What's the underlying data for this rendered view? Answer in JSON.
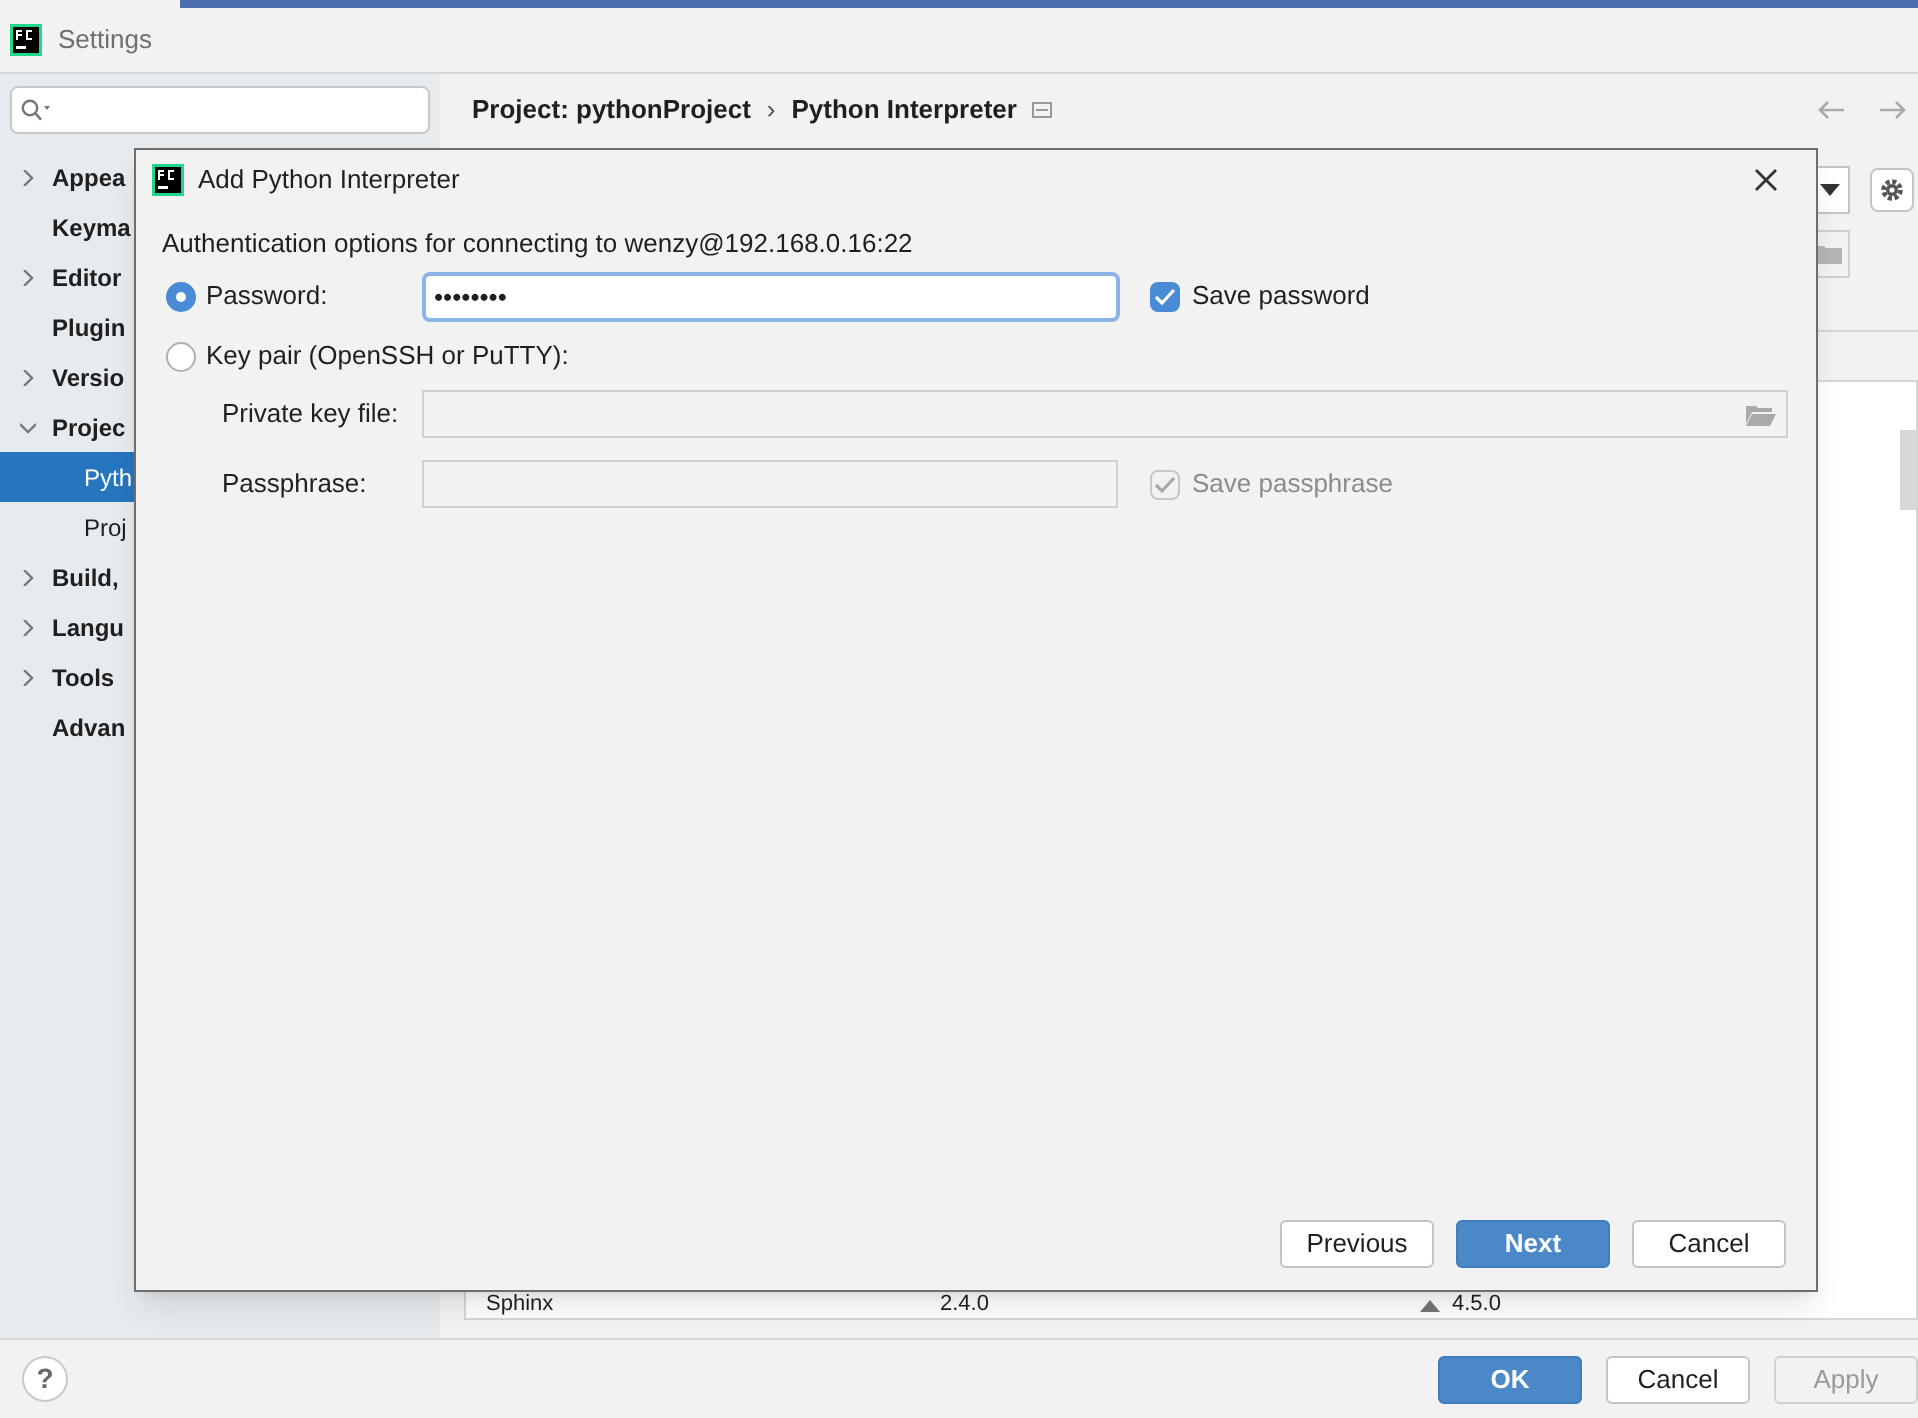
{
  "window": {
    "title": "Settings"
  },
  "sidebar": {
    "items": [
      {
        "label": "Appea",
        "expanded": false,
        "selected": false
      },
      {
        "label": "Keyma",
        "selected": false
      },
      {
        "label": "Editor",
        "expanded": false,
        "selected": false
      },
      {
        "label": "Plugin",
        "selected": false
      },
      {
        "label": "Versio",
        "expanded": false,
        "selected": false
      },
      {
        "label": "Projec",
        "expanded": true,
        "selected": false,
        "children": [
          {
            "label": "Pyth",
            "selected": true
          },
          {
            "label": "Proj",
            "selected": false
          }
        ]
      },
      {
        "label": "Build,",
        "expanded": false,
        "selected": false
      },
      {
        "label": "Langu",
        "expanded": false,
        "selected": false
      },
      {
        "label": "Tools",
        "expanded": false,
        "selected": false
      },
      {
        "label": "Advan",
        "selected": false
      }
    ]
  },
  "breadcrumb": [
    "Project: pythonProject",
    "›",
    "Python Interpreter"
  ],
  "package_table": {
    "rows": [
      {
        "name": "Sphinx",
        "version": "2.4.0",
        "latest": "4.5.0"
      }
    ]
  },
  "help_button": {
    "label": "?"
  },
  "dialog": {
    "title": "Add Python Interpreter",
    "subtitle": "Authentication options for connecting to wenzy@192.168.0.16:22",
    "auth_options": [
      {
        "label": "Password:",
        "selected": true
      },
      {
        "label": "Key pair (OpenSSH or PuTTY):",
        "selected": false
      }
    ],
    "password": {
      "value": "••••••••"
    },
    "save_password": {
      "label": "Save password",
      "checked": true,
      "disabled": false
    },
    "private_key_file": {
      "label": "Private key file:",
      "disabled": true
    },
    "passphrase": {
      "label": "Passphrase:",
      "disabled": true
    },
    "save_passphrase": {
      "label": "Save passphrase",
      "checked": true,
      "disabled": true
    },
    "buttons": [
      {
        "label": "Previous",
        "kind": "secondary"
      },
      {
        "label": "Next",
        "kind": "primary"
      },
      {
        "label": "Cancel",
        "kind": "secondary"
      }
    ]
  },
  "footer_buttons": [
    {
      "label": "OK",
      "kind": "primary"
    },
    {
      "label": "Cancel",
      "kind": "secondary"
    },
    {
      "label": "Apply",
      "kind": "disabled"
    }
  ]
}
